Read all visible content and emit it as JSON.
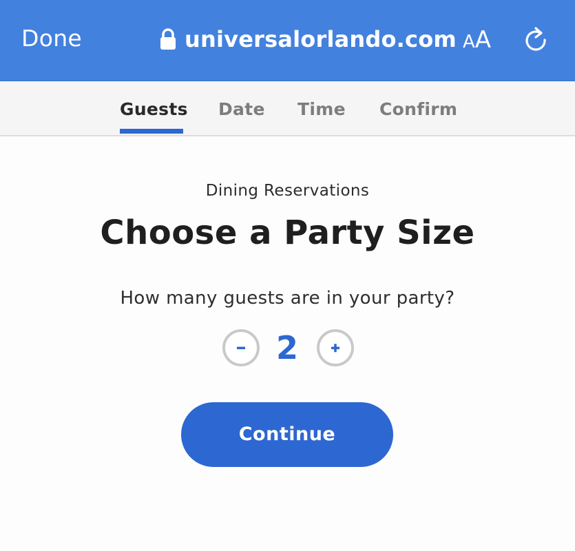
{
  "browser": {
    "done_label": "Done",
    "url": "universalorlando.com",
    "text_size_small": "A",
    "text_size_large": "A",
    "lock_icon": "lock-icon",
    "reload_icon": "reload-icon",
    "bar_color": "#4381de"
  },
  "tabs": [
    {
      "label": "Guests",
      "active": true
    },
    {
      "label": "Date",
      "active": false
    },
    {
      "label": "Time",
      "active": false
    },
    {
      "label": "Confirm",
      "active": false
    }
  ],
  "main": {
    "subtitle": "Dining Reservations",
    "title": "Choose a Party Size",
    "question": "How many guests are in your party?",
    "party_size": "2",
    "minus_icon": "minus-icon",
    "plus_icon": "plus-icon",
    "continue_label": "Continue",
    "accent_color": "#2d67d1"
  }
}
